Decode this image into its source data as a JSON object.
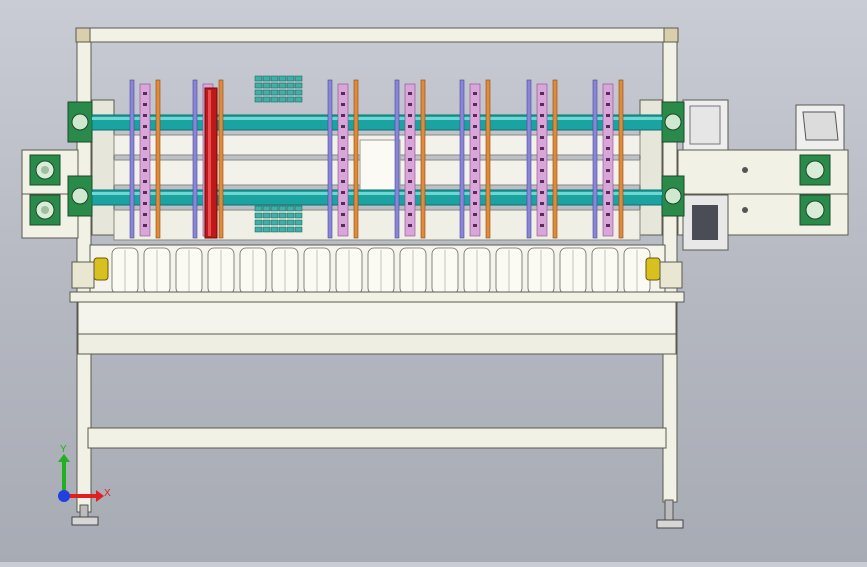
{
  "viewport": {
    "title": "",
    "background_top": "#c9ccd4",
    "background_bottom": "#a7abb4"
  },
  "triad": {
    "x_label": "X",
    "y_label": "Y",
    "x_color": "#e02020",
    "y_color": "#20b020",
    "z_color": "#2040e0"
  },
  "colors": {
    "frame": "#f2f1e6",
    "frame_edge": "#5a5a50",
    "beam_tan": "#d9cfae",
    "shaft": "#1aa3a0",
    "shaft_dark": "#0d6f6c",
    "belt_pink": "#d9a6d9",
    "blade_purple": "#8a86d6",
    "blade_orange": "#e08a3a",
    "red_wheel": "#c01818",
    "bearing_green": "#2a8a4a",
    "caster_yellow": "#d8c020",
    "gear_teal": "#3fb0a8"
  },
  "icons": {
    "triad": "axis-triad-icon"
  }
}
